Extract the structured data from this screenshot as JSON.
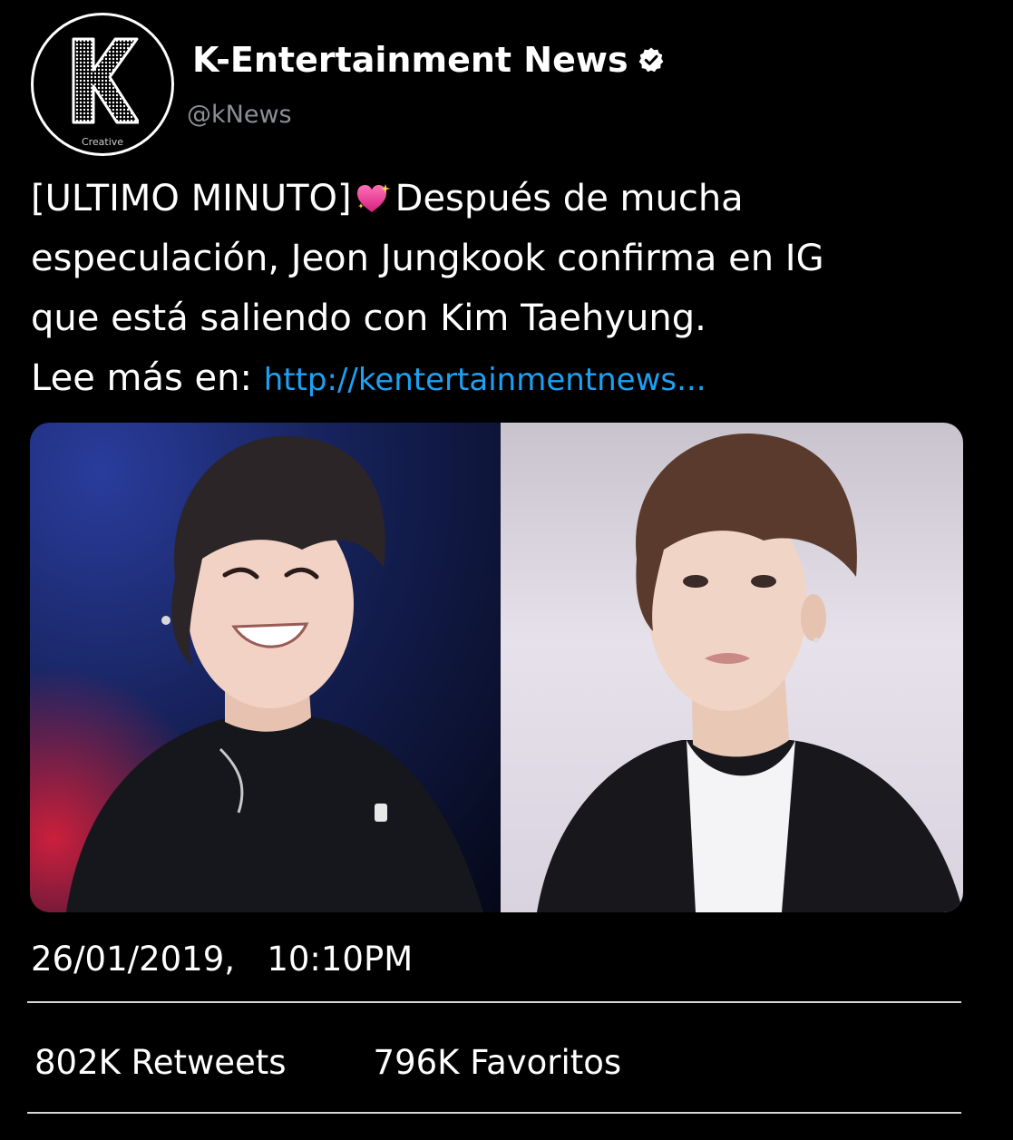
{
  "account": {
    "display_name": "K-Entertainment News",
    "handle": "@kNews",
    "avatar_letter": "K",
    "avatar_caption": "Creative",
    "verified": true,
    "verified_icon": "verified-badge-icon"
  },
  "tweet": {
    "line1_prefix": "[ULTIMO MINUTO]",
    "line1_emoji": "sparkling-heart-icon",
    "line1_suffix": "Después de mucha",
    "line2": "especulación, Jeon Jungkook confirma en IG",
    "line3": "que está saliendo con Kim Taehyung.",
    "line4_prefix": "Lee más en: ",
    "link_text": "http://kentertainmentnews..."
  },
  "timestamp": {
    "date": "26/01/2019,",
    "time": "10:10PM"
  },
  "stats": {
    "retweets": "802K Retweets",
    "favorites": "796K Favoritos"
  },
  "colors": {
    "background": "#000000",
    "link": "#1da1f2",
    "handle": "#8b8f94",
    "text": "#ffffff"
  }
}
